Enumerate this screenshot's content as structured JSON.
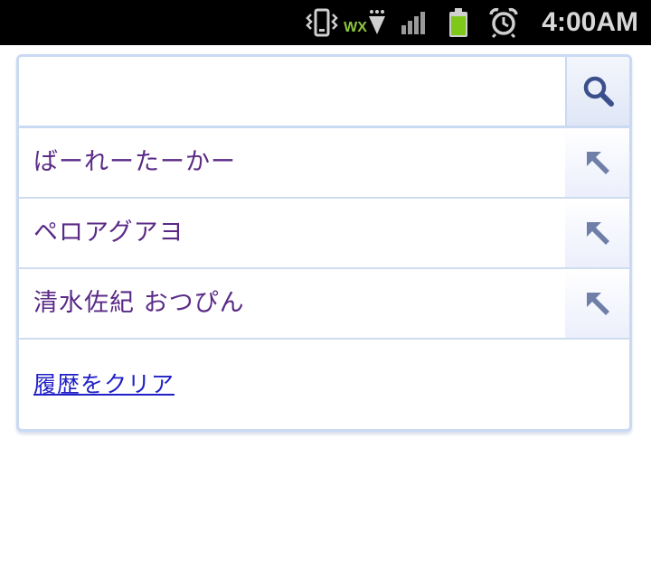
{
  "status_bar": {
    "time": "4:00AM",
    "network_label": "WX",
    "icons": [
      "vibrate-icon",
      "wifi-icon",
      "signal-icon",
      "battery-icon",
      "alarm-icon"
    ],
    "colors": {
      "background": "#000000",
      "battery": "#7ec81a",
      "network": "#8cc63f"
    }
  },
  "search": {
    "input_value": "",
    "button_icon": "search-icon"
  },
  "suggestions": [
    {
      "text": "ばーれーたーかー",
      "action_icon": "arrow-up-left-icon"
    },
    {
      "text": "ペロアグアヨ",
      "action_icon": "arrow-up-left-icon"
    },
    {
      "text": "清水佐紀 おつぴん",
      "action_icon": "arrow-up-left-icon"
    }
  ],
  "clear_history_label": "履歴をクリア",
  "colors": {
    "border": "#c9daf2",
    "suggestion_text": "#5a2a86",
    "link": "#2020c8",
    "icon": "#6f7fa8"
  }
}
